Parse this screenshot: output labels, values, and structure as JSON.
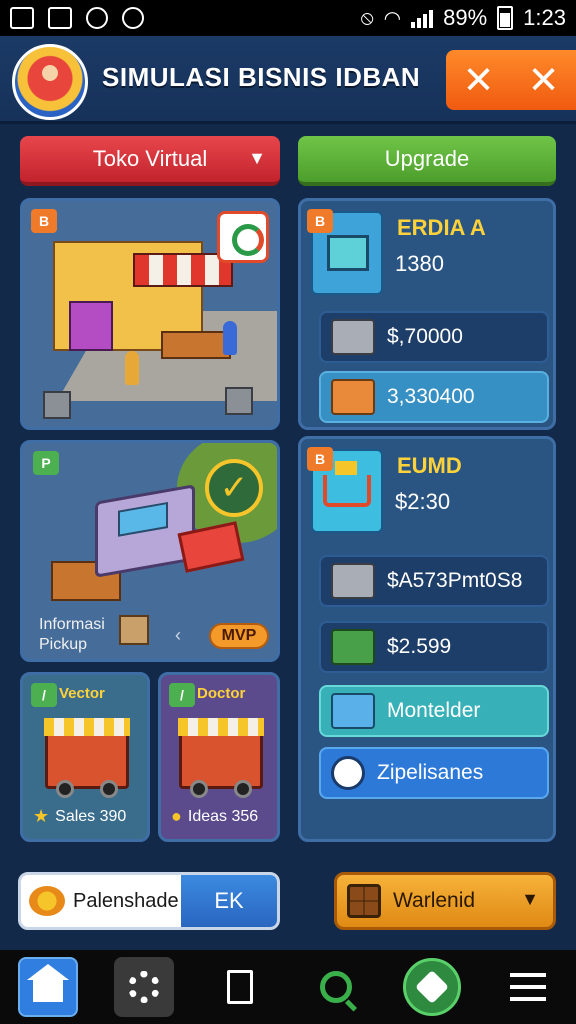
{
  "status_bar": {
    "battery": "89%",
    "time": "1:23"
  },
  "header": {
    "title": "SIMULASI BISNIS IDBAN",
    "close_labels": [
      "✕",
      "✕"
    ]
  },
  "top_buttons": {
    "dropdown_label": "Toko Virtual",
    "upgrade_label": "Upgrade"
  },
  "scenes": {
    "truck_caption_line1": "Informasi",
    "truck_caption_line2": "Pickup",
    "truck_button": "MVP"
  },
  "food_cards": [
    {
      "title": "Vector",
      "stat": "Sales 390"
    },
    {
      "title": "Doctor",
      "stat": "Ideas 356"
    }
  ],
  "right_panel_top": {
    "item_name": "ERDIA A",
    "item_value": "1380",
    "rows": [
      "$,70000",
      "3,330400"
    ]
  },
  "right_panel_bottom": {
    "item_name": "EUMD",
    "item_value": "$2:30",
    "rows": [
      "$A573Pmt0S8",
      "$2.599",
      "Montelder",
      "Zipelisanes"
    ]
  },
  "action_bar": {
    "pill_text": "Palenshade",
    "pill_button": "EK",
    "dropdown_text": "Warlenid"
  },
  "colors": {
    "accent_orange": "#f05a10",
    "red_button": "#c2232c",
    "green_button": "#4d9e2c",
    "panel_bg": "#2b4f7c"
  }
}
